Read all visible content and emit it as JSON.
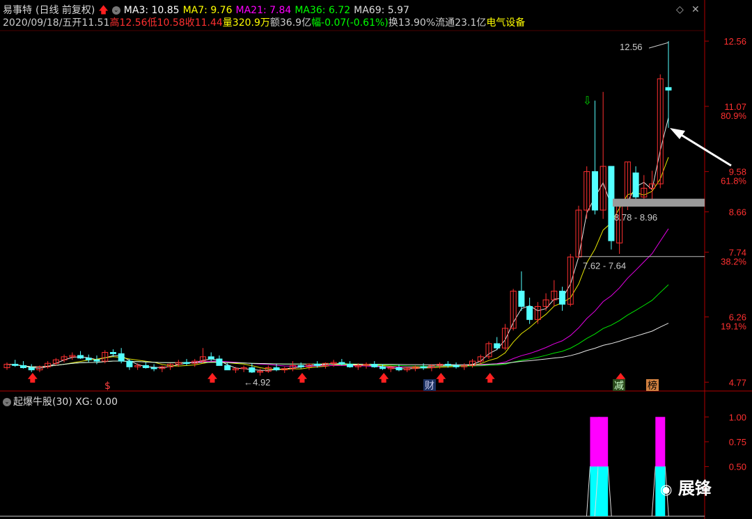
{
  "header": {
    "stock_name": "易事特",
    "period": "(日线 前复权)",
    "ma": [
      {
        "label": "MA3: 10.85",
        "color": "#ffffff"
      },
      {
        "label": "MA7: 9.76",
        "color": "#ffff00"
      },
      {
        "label": "MA21: 7.84",
        "color": "#ff00ff"
      },
      {
        "label": "MA36: 6.72",
        "color": "#00ff00"
      },
      {
        "label": "MA69: 5.97",
        "color": "#ffffff"
      }
    ],
    "date": "2020/09/18/五",
    "open": "开11.51",
    "high": "高12.56",
    "low": "低10.58",
    "close": "收11.44",
    "volume": "量320.9万",
    "amount": "额36.9亿",
    "change": "幅-0.07(-0.61%)",
    "turnover": "换13.90%",
    "float": "流通23.1亿",
    "sector": "电气设备"
  },
  "colors": {
    "up": "#ff3030",
    "down": "#54ffff",
    "bg": "#000000",
    "axis": "#b00000"
  },
  "chart_data": [
    {
      "type": "candlestick",
      "title": "",
      "y_axis_labels": [
        "12.56",
        "11.07",
        "9.58",
        "8.66",
        "7.74",
        "6.26",
        "4.77"
      ],
      "y_percent_labels": [
        "80.9%",
        "61.8%",
        "38.2%",
        "19.1%"
      ],
      "ylim": [
        4.6,
        12.8
      ],
      "annotations": [
        "12.56",
        "8.78 - 8.96",
        "7.62 - 7.64",
        "4.92"
      ],
      "event_markers": [
        "$",
        "财",
        "减",
        "榜"
      ],
      "ohlc": [
        [
          5.1,
          5.22,
          5.05,
          5.18
        ],
        [
          5.18,
          5.28,
          5.12,
          5.15
        ],
        [
          5.15,
          5.25,
          5.08,
          5.1
        ],
        [
          5.1,
          5.18,
          5.0,
          5.05
        ],
        [
          5.05,
          5.15,
          5.0,
          5.12
        ],
        [
          5.12,
          5.25,
          5.08,
          5.2
        ],
        [
          5.2,
          5.32,
          5.15,
          5.28
        ],
        [
          5.28,
          5.4,
          5.22,
          5.35
        ],
        [
          5.35,
          5.45,
          5.28,
          5.38
        ],
        [
          5.38,
          5.48,
          5.3,
          5.32
        ],
        [
          5.32,
          5.4,
          5.22,
          5.28
        ],
        [
          5.28,
          5.38,
          5.18,
          5.25
        ],
        [
          5.25,
          5.5,
          5.2,
          5.45
        ],
        [
          5.45,
          5.52,
          5.35,
          5.42
        ],
        [
          5.42,
          5.55,
          5.2,
          5.25
        ],
        [
          5.25,
          5.3,
          5.05,
          5.12
        ],
        [
          5.12,
          5.2,
          5.05,
          5.15
        ],
        [
          5.15,
          5.22,
          5.08,
          5.1
        ],
        [
          5.1,
          5.18,
          5.02,
          5.08
        ],
        [
          5.08,
          5.15,
          5.0,
          5.12
        ],
        [
          5.12,
          5.2,
          5.05,
          5.18
        ],
        [
          5.18,
          5.28,
          5.12,
          5.22
        ],
        [
          5.22,
          5.3,
          5.15,
          5.2
        ],
        [
          5.2,
          5.3,
          5.12,
          5.25
        ],
        [
          5.25,
          5.55,
          5.2,
          5.35
        ],
        [
          5.35,
          5.45,
          5.25,
          5.3
        ],
        [
          5.3,
          5.38,
          5.2,
          5.15
        ],
        [
          5.15,
          5.2,
          5.05,
          5.05
        ],
        [
          5.05,
          5.12,
          4.98,
          5.08
        ],
        [
          5.08,
          5.15,
          5.0,
          5.1
        ],
        [
          5.1,
          5.2,
          4.98,
          5.0
        ],
        [
          5.0,
          5.08,
          4.92,
          5.02
        ],
        [
          5.02,
          5.15,
          4.98,
          5.1
        ],
        [
          5.1,
          5.18,
          5.02,
          5.05
        ],
        [
          5.05,
          5.12,
          4.98,
          5.08
        ],
        [
          5.08,
          5.25,
          5.02,
          5.15
        ],
        [
          5.15,
          5.22,
          5.08,
          5.12
        ],
        [
          5.12,
          5.2,
          5.05,
          5.18
        ],
        [
          5.18,
          5.25,
          5.1,
          5.15
        ],
        [
          5.15,
          5.22,
          5.08,
          5.2
        ],
        [
          5.2,
          5.28,
          5.12,
          5.22
        ],
        [
          5.22,
          5.3,
          5.15,
          5.18
        ],
        [
          5.18,
          5.25,
          5.1,
          5.12
        ],
        [
          5.12,
          5.2,
          5.05,
          5.15
        ],
        [
          5.15,
          5.22,
          5.08,
          5.18
        ],
        [
          5.18,
          5.25,
          5.1,
          5.12
        ],
        [
          5.12,
          5.18,
          5.05,
          5.08
        ],
        [
          5.08,
          5.15,
          5.0,
          5.1
        ],
        [
          5.1,
          5.18,
          5.02,
          5.05
        ],
        [
          5.05,
          5.12,
          5.0,
          5.08
        ],
        [
          5.08,
          5.15,
          5.02,
          5.12
        ],
        [
          5.12,
          5.2,
          5.05,
          5.1
        ],
        [
          5.1,
          5.18,
          5.02,
          5.15
        ],
        [
          5.15,
          5.22,
          5.08,
          5.18
        ],
        [
          5.18,
          5.25,
          5.1,
          5.15
        ],
        [
          5.15,
          5.22,
          5.08,
          5.12
        ],
        [
          5.12,
          5.2,
          5.05,
          5.15
        ],
        [
          5.15,
          5.3,
          5.1,
          5.25
        ],
        [
          5.25,
          5.4,
          5.18,
          5.35
        ],
        [
          5.35,
          5.7,
          5.3,
          5.65
        ],
        [
          5.65,
          5.8,
          5.5,
          5.55
        ],
        [
          5.55,
          6.1,
          5.5,
          6.0
        ],
        [
          6.0,
          6.9,
          5.95,
          6.85
        ],
        [
          6.85,
          7.3,
          6.4,
          6.5
        ],
        [
          6.5,
          6.7,
          6.1,
          6.2
        ],
        [
          6.2,
          6.6,
          6.1,
          6.5
        ],
        [
          6.5,
          6.8,
          6.4,
          6.65
        ],
        [
          6.65,
          7.1,
          6.5,
          6.85
        ],
        [
          6.85,
          6.95,
          6.4,
          6.55
        ],
        [
          6.55,
          7.7,
          6.5,
          7.63
        ],
        [
          7.63,
          8.8,
          7.6,
          8.7
        ],
        [
          8.7,
          9.7,
          8.5,
          9.58
        ],
        [
          9.58,
          11.2,
          8.6,
          8.7
        ],
        [
          8.7,
          11.4,
          8.5,
          9.7
        ],
        [
          9.7,
          9.6,
          7.8,
          8.0
        ],
        [
          7.95,
          8.8,
          7.7,
          8.9
        ],
        [
          8.9,
          9.8,
          8.7,
          9.8
        ],
        [
          9.55,
          9.7,
          8.95,
          9.0
        ],
        [
          9.0,
          9.5,
          8.9,
          9.2
        ],
        [
          9.2,
          9.6,
          8.95,
          9.3
        ],
        [
          9.3,
          11.8,
          9.2,
          11.7
        ],
        [
          11.5,
          12.56,
          10.58,
          11.44
        ]
      ],
      "ma_series": [
        {
          "name": "MA3",
          "color": "#ffffff"
        },
        {
          "name": "MA7",
          "color": "#ffff00"
        },
        {
          "name": "MA21",
          "color": "#ff00ff"
        },
        {
          "name": "MA36",
          "color": "#00ff00"
        },
        {
          "name": "MA69",
          "color": "#ffffff"
        }
      ]
    },
    {
      "type": "bar",
      "title": "起爆牛股(30)",
      "legend": "XG: 0.00",
      "y_axis_labels": [
        "1.00",
        "0.75",
        "0.50"
      ],
      "ylim": [
        0,
        1.1
      ],
      "signal_bars": [
        {
          "index": 72,
          "value": 1.0
        },
        {
          "index": 73,
          "value": 1.0
        },
        {
          "index": 80,
          "value": 1.0
        }
      ]
    }
  ],
  "watermark": "展锋"
}
